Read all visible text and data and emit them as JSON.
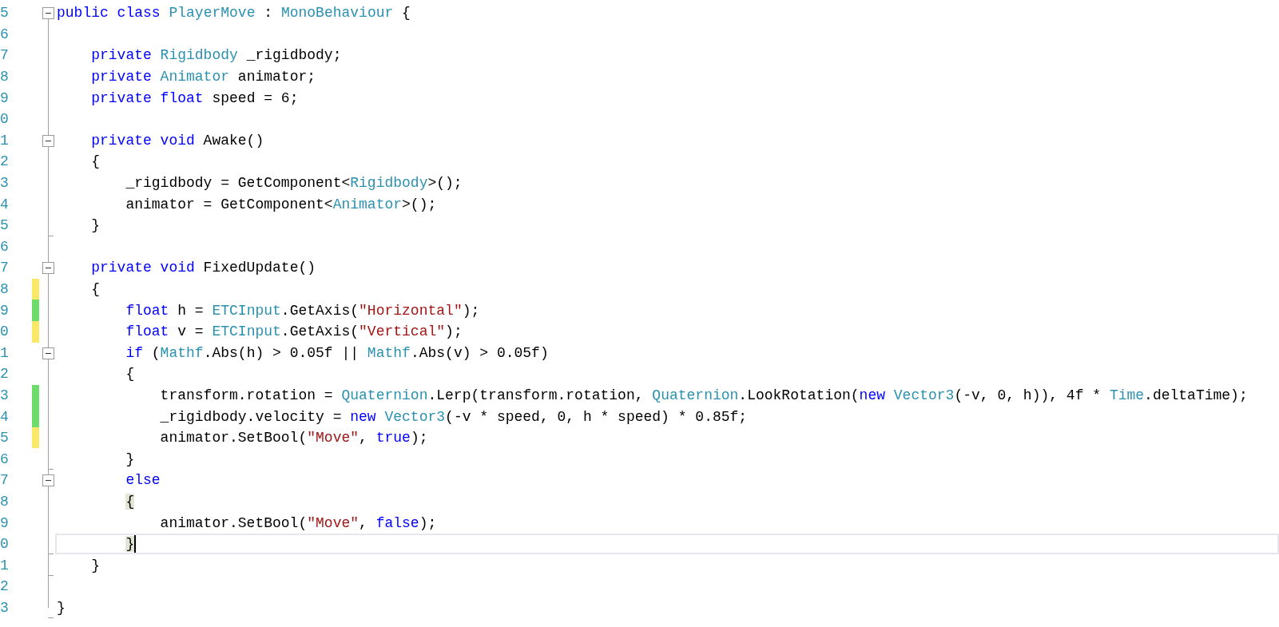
{
  "editor": {
    "lines": [
      {
        "number": "5",
        "collapsible": true,
        "tokens": [
          {
            "kind": "keyword",
            "text": "public class "
          },
          {
            "kind": "type",
            "text": "PlayerMove"
          },
          {
            "kind": "plain",
            "text": " : "
          },
          {
            "kind": "type",
            "text": "MonoBehaviour"
          },
          {
            "kind": "plain",
            "text": " {"
          }
        ],
        "children": [
          {
            "number": "6"
          },
          {
            "number": "7",
            "tokens": [
              {
                "kind": "keyword",
                "text": "private "
              },
              {
                "kind": "type",
                "text": "Rigidbody"
              },
              {
                "kind": "plain",
                "text": " _rigidbody;"
              }
            ]
          },
          {
            "number": "8",
            "tokens": [
              {
                "kind": "keyword",
                "text": "private "
              },
              {
                "kind": "type",
                "text": "Animator"
              },
              {
                "kind": "plain",
                "text": " animator;"
              }
            ]
          },
          {
            "number": "9",
            "tokens": [
              {
                "kind": "keyword",
                "text": "private float"
              },
              {
                "kind": "plain",
                "text": " speed = 6;"
              }
            ]
          },
          {
            "number": "0"
          },
          {
            "number": "1",
            "collapsible": true,
            "tokens": [
              {
                "kind": "keyword",
                "text": "private void"
              },
              {
                "kind": "plain",
                "text": " Awake()"
              }
            ]
          },
          {
            "number": "2",
            "tokens": [
              {
                "kind": "plain",
                "text": "{"
              }
            ],
            "children": [
              {
                "number": "3",
                "tokens": [
                  {
                    "kind": "plain",
                    "text": "_rigidbody = GetComponent<"
                  },
                  {
                    "kind": "type",
                    "text": "Rigidbody"
                  },
                  {
                    "kind": "plain",
                    "text": ">();"
                  }
                ]
              },
              {
                "number": "4",
                "tokens": [
                  {
                    "kind": "plain",
                    "text": "animator = GetComponent<"
                  },
                  {
                    "kind": "type",
                    "text": "Animator"
                  },
                  {
                    "kind": "plain",
                    "text": ">();"
                  }
                ]
              }
            ]
          },
          {
            "number": "5",
            "block_end": true,
            "tokens": [
              {
                "kind": "plain",
                "text": "}"
              }
            ]
          },
          {
            "number": "6"
          },
          {
            "number": "7",
            "collapsible": true,
            "tokens": [
              {
                "kind": "keyword",
                "text": "private void"
              },
              {
                "kind": "plain",
                "text": " FixedUpdate()"
              }
            ]
          },
          {
            "number": "8",
            "modified": true,
            "saved": false,
            "tokens": [
              {
                "kind": "plain",
                "text": "{"
              }
            ],
            "children": [
              {
                "number": "9",
                "modified": true,
                "saved": true,
                "tokens": [
                  {
                    "kind": "keyword",
                    "text": "float"
                  },
                  {
                    "kind": "plain",
                    "text": " h = "
                  },
                  {
                    "kind": "type",
                    "text": "ETCInput"
                  },
                  {
                    "kind": "plain",
                    "text": ".GetAxis("
                  },
                  {
                    "kind": "string",
                    "text": "\"Horizontal\""
                  },
                  {
                    "kind": "plain",
                    "text": ");"
                  }
                ]
              },
              {
                "number": "0",
                "modified": true,
                "saved": false,
                "tokens": [
                  {
                    "kind": "keyword",
                    "text": "float"
                  },
                  {
                    "kind": "plain",
                    "text": " v = "
                  },
                  {
                    "kind": "type",
                    "text": "ETCInput"
                  },
                  {
                    "kind": "plain",
                    "text": ".GetAxis("
                  },
                  {
                    "kind": "string",
                    "text": "\"Vertical\""
                  },
                  {
                    "kind": "plain",
                    "text": ");"
                  }
                ]
              },
              {
                "number": "1",
                "collapsible": true,
                "tokens": [
                  {
                    "kind": "keyword",
                    "text": "if"
                  },
                  {
                    "kind": "plain",
                    "text": " ("
                  },
                  {
                    "kind": "type",
                    "text": "Mathf"
                  },
                  {
                    "kind": "plain",
                    "text": ".Abs(h) > 0.05f || "
                  },
                  {
                    "kind": "type",
                    "text": "Mathf"
                  },
                  {
                    "kind": "plain",
                    "text": ".Abs(v) > 0.05f)"
                  }
                ]
              },
              {
                "number": "2",
                "tokens": [
                  {
                    "kind": "plain",
                    "text": "{"
                  }
                ],
                "children": [
                  {
                    "number": "3",
                    "modified": true,
                    "saved": true,
                    "tokens": [
                      {
                        "kind": "plain",
                        "text": "transform.rotation = "
                      },
                      {
                        "kind": "type",
                        "text": "Quaternion"
                      },
                      {
                        "kind": "plain",
                        "text": ".Lerp(transform.rotation, "
                      },
                      {
                        "kind": "type",
                        "text": "Quaternion"
                      },
                      {
                        "kind": "plain",
                        "text": ".LookRotation("
                      },
                      {
                        "kind": "keyword",
                        "text": "new "
                      },
                      {
                        "kind": "type",
                        "text": "Vector3"
                      },
                      {
                        "kind": "plain",
                        "text": "(-v, 0, h)), 4f * "
                      },
                      {
                        "kind": "type",
                        "text": "Time"
                      },
                      {
                        "kind": "plain",
                        "text": ".deltaTime);"
                      }
                    ]
                  },
                  {
                    "number": "4",
                    "modified": true,
                    "saved": true,
                    "tokens": [
                      {
                        "kind": "plain",
                        "text": "_rigidbody.velocity = "
                      },
                      {
                        "kind": "keyword",
                        "text": "new "
                      },
                      {
                        "kind": "type",
                        "text": "Vector3"
                      },
                      {
                        "kind": "plain",
                        "text": "(-v * speed, 0, h * speed) * 0.85f;"
                      }
                    ]
                  },
                  {
                    "number": "5",
                    "modified": true,
                    "saved": false,
                    "tokens": [
                      {
                        "kind": "plain",
                        "text": "animator.SetBool("
                      },
                      {
                        "kind": "string",
                        "text": "\"Move\""
                      },
                      {
                        "kind": "plain",
                        "text": ", "
                      },
                      {
                        "kind": "keyword",
                        "text": "true"
                      },
                      {
                        "kind": "plain",
                        "text": ");"
                      }
                    ]
                  }
                ]
              },
              {
                "number": "6",
                "block_end": true,
                "tokens": [
                  {
                    "kind": "plain",
                    "text": "}"
                  }
                ]
              },
              {
                "number": "7",
                "collapsible": true,
                "tokens": [
                  {
                    "kind": "keyword",
                    "text": "else"
                  }
                ]
              },
              {
                "number": "8",
                "tokens": [
                  {
                    "kind": "brace",
                    "text": "{"
                  }
                ],
                "children": [
                  {
                    "number": "9",
                    "tokens": [
                      {
                        "kind": "plain",
                        "text": "animator.SetBool("
                      },
                      {
                        "kind": "string",
                        "text": "\"Move\""
                      },
                      {
                        "kind": "plain",
                        "text": ", "
                      },
                      {
                        "kind": "keyword",
                        "text": "false"
                      },
                      {
                        "kind": "plain",
                        "text": ");"
                      }
                    ]
                  }
                ]
              },
              {
                "number": "0",
                "block_end": true,
                "current": true,
                "tokens": [
                  {
                    "kind": "brace",
                    "text": "}"
                  }
                ]
              }
            ]
          },
          {
            "number": "1",
            "block_end": true,
            "tokens": [
              {
                "kind": "plain",
                "text": "}"
              }
            ]
          },
          {
            "number": "2"
          }
        ]
      },
      {
        "number": "3",
        "block_end": true,
        "tokens": [
          {
            "kind": "plain",
            "text": "}"
          }
        ]
      }
    ]
  }
}
